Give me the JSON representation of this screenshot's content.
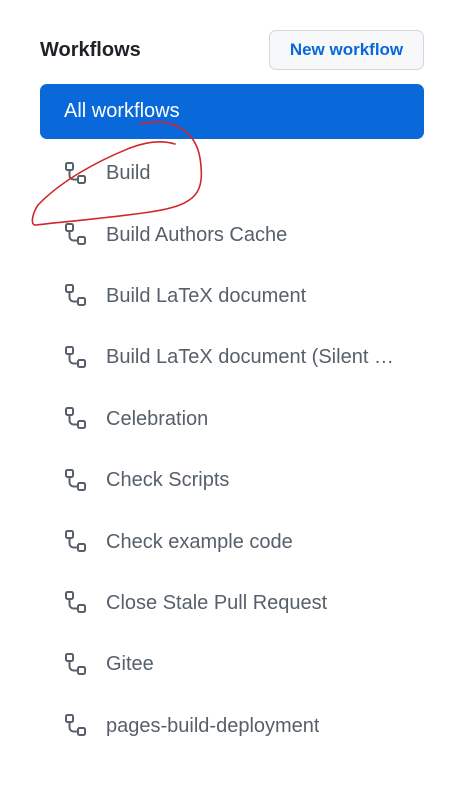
{
  "header": {
    "title": "Workflows",
    "new_workflow_label": "New workflow"
  },
  "all_workflows_label": "All workflows",
  "workflows": [
    {
      "label": "Build",
      "icon": "workflow-icon"
    },
    {
      "label": "Build Authors Cache",
      "icon": "workflow-icon"
    },
    {
      "label": "Build LaTeX document",
      "icon": "workflow-icon"
    },
    {
      "label": "Build LaTeX document (Silent …",
      "icon": "workflow-icon"
    },
    {
      "label": "Celebration",
      "icon": "workflow-icon"
    },
    {
      "label": "Check Scripts",
      "icon": "workflow-icon"
    },
    {
      "label": "Check example code",
      "icon": "workflow-icon"
    },
    {
      "label": "Close Stale Pull Request",
      "icon": "workflow-icon"
    },
    {
      "label": "Gitee",
      "icon": "workflow-icon"
    },
    {
      "label": "pages-build-deployment",
      "icon": "workflow-icon"
    }
  ],
  "colors": {
    "accent": "#0969da",
    "annotation": "#d0262e"
  }
}
